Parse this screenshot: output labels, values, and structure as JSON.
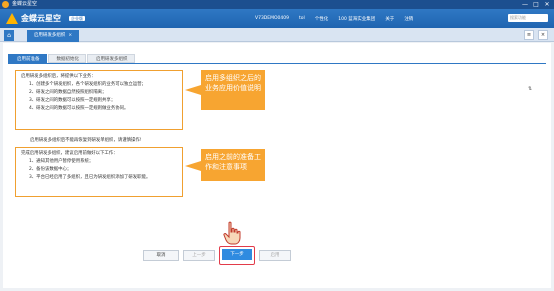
{
  "window": {
    "title": "金蝶云星空",
    "controls": [
      "—",
      "□",
      "✕"
    ]
  },
  "header": {
    "brand": "金蝶云星空",
    "badge": "企业版",
    "user_code": "V73DEMO0409",
    "user": "tol",
    "personalize": "个性化",
    "org": "100 蓝海实业集团",
    "about": "关于",
    "logout": "注销",
    "search_placeholder": "搜索功能"
  },
  "tabs": {
    "home_icon": "home-icon",
    "active": "启用研发多组织",
    "close": "×",
    "tools": [
      "≡",
      "×"
    ]
  },
  "steps": [
    "启用前准备",
    "数据初始化",
    "启用研发多组织"
  ],
  "callout1": {
    "line1": "启用研发多组织后，将提供以下业务：",
    "items": [
      "1、创建多个研发组织，各个研发组织的业务可以独立运营；",
      "2、研发之间的数据自然按照组织隔离；",
      "3、研发之间的数据可以按照一定规则共享；",
      "4、研发之间的数据可以按照一定规则做业务协同。"
    ]
  },
  "note": "启用研发多组织后不能再恢复到研发单组织，请谨慎操作!",
  "callout2": {
    "line1": "完成启用研发多组织，建议启用前做好以下工作：",
    "items": [
      "1、通知其他用户暂停使用系统；",
      "2、备份该数据中心；",
      "3、平台已经启用了多组织，且已为研发组织添加了研发职能。"
    ]
  },
  "annotations": {
    "a1": "启用多组织之后的业务应用价值说明",
    "a2": "启用之前的准备工作和注意事项"
  },
  "side_icon": "⇅",
  "buttons": {
    "cancel": "取消",
    "prev": "上一步",
    "next": "下一步",
    "enable": "启用"
  }
}
